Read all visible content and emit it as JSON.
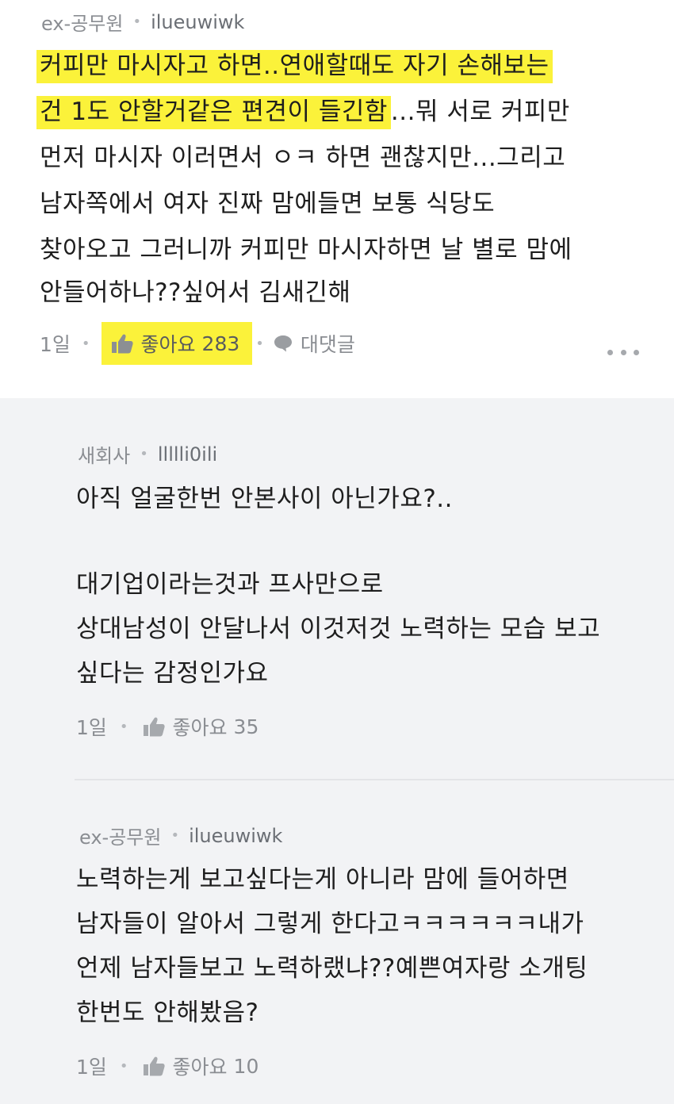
{
  "main_comment": {
    "author_company": "ex-공무원",
    "author_name": "ilueuwiwk",
    "lines": [
      "커피만 마시자고 하면..연애할때도 자기 손해보는",
      "건 1도 안할거같은 편견이 들긴함",
      "...뭐 서로 커피만",
      "먼저 마시자 이러면서 ㅇㅋ 하면 괜찮지만...그리고",
      "남자쪽에서 여자 진짜 맘에들면 보통 식당도",
      "찾아오고 그러니까 커피만 마시자하면 날 별로 맘에",
      "안들어하나??싶어서 김새긴해"
    ],
    "time": "1일",
    "like_label": "좋아요",
    "like_count": "283",
    "reply_label": "대댓글",
    "highlight_color": "#fbf23a"
  },
  "replies": [
    {
      "author_company": "새회사",
      "author_name": "llllli0ili",
      "lines": [
        "아직 얼굴한번 안본사이 아닌가요?..",
        "대기업이라는것과 프사만으로",
        "상대남성이 안달나서 이것저것 노력하는 모습 보고",
        "싶다는 감정인가요"
      ],
      "time": "1일",
      "like_label": "좋아요",
      "like_count": "35"
    },
    {
      "author_company": "ex-공무원",
      "author_name": "ilueuwiwk",
      "lines": [
        "노력하는게 보고싶다는게 아니라 맘에 들어하면",
        "남자들이 알아서 그렇게 한다고ㅋㅋㅋㅋㅋㅋ내가",
        "언제 남자들보고 노력하랬냐??예쁜여자랑 소개팅",
        "한번도 안해봤음?"
      ],
      "time": "1일",
      "like_label": "좋아요",
      "like_count": "10"
    }
  ],
  "icons": {
    "like": "thumbs-up-icon",
    "reply": "speech-bubble-icon",
    "more": "more-dots-icon"
  }
}
